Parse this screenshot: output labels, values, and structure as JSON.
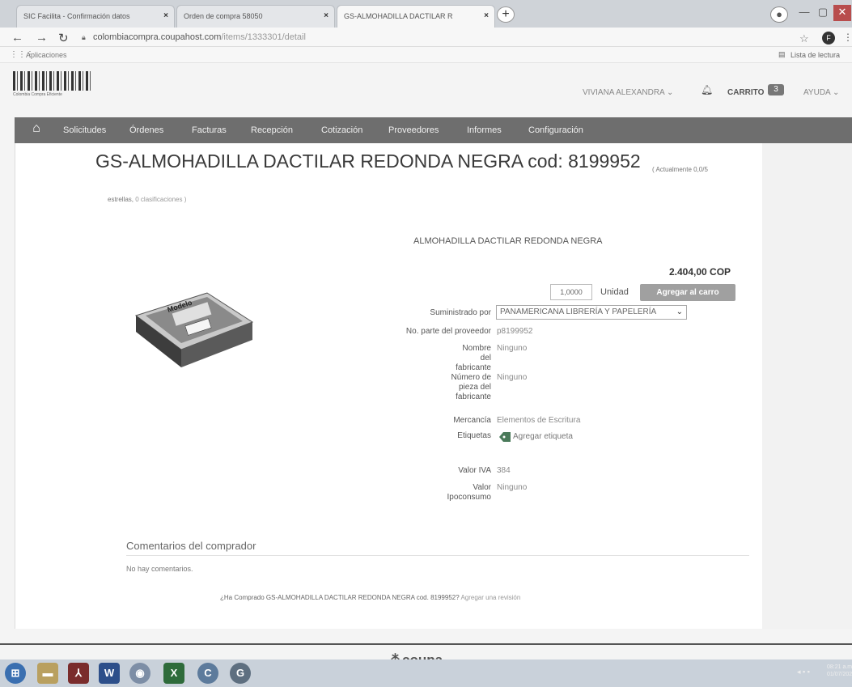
{
  "browser": {
    "tabs": [
      {
        "label": "SIC Facilita - Confirmación datos",
        "close": "×"
      },
      {
        "label": "Orden de compra 58050",
        "close": "×"
      },
      {
        "label": "GS-ALMOHADILLA DACTILAR R",
        "close": "×"
      }
    ],
    "new_tab": "+",
    "url_host": "colombiacompra.coupahost.com",
    "url_path": "/items/1333301/detail",
    "bookmarks_label": "Aplicaciones",
    "reading_list": "Lista de lectura",
    "profile_initial": "F"
  },
  "header": {
    "logo_caption": "Colombia Compra Eficiente",
    "user": "VIVIANA ALEXANDRA",
    "cart_label": "CARRITO",
    "cart_count": "3",
    "help": "AYUDA"
  },
  "nav": {
    "items": [
      "Solicitudes",
      "Órdenes",
      "Facturas",
      "Recepción",
      "Cotización",
      "Proveedores",
      "Informes",
      "Configuración"
    ]
  },
  "item": {
    "title": "GS-ALMOHADILLA DACTILAR REDONDA NEGRA cod: 8199952",
    "rating_part1": "( Actualmente 0,0/5",
    "rating_part2a": "estrellas,",
    "rating_part2b": "0 clasificaciones )",
    "product_name": "ALMOHADILLA DACTILAR REDONDA NEGRA",
    "price": "2.404,00 COP",
    "quantity": "1,0000",
    "unit": "Unidad",
    "add_to_cart": "Agregar al carro",
    "supplier_label": "Suministrado por",
    "supplier_value": "PANAMERICANA LIBRERÍA Y PAPELERÍA",
    "part_label": "No. parte del proveedor",
    "part_value": "p8199952",
    "mfr_name_label": "Nombre del fabricante",
    "mfr_name_value": "Ninguno",
    "mfr_part_label": "Número de pieza del fabricante",
    "mfr_part_value": "Ninguno",
    "commodity_label": "Mercancía",
    "commodity_value": "Elementos de Escritura",
    "tags_label": "Etiquetas",
    "tags_value": "Agregar etiqueta",
    "iva_label": "Valor IVA",
    "iva_value": "384",
    "ipo_label": "Valor Ipoconsumo",
    "ipo_value": "Ninguno"
  },
  "comments": {
    "title": "Comentarios del comprador",
    "empty": "No hay comentarios.",
    "review_question": "¿Ha Comprado GS-ALMOHADILLA DACTILAR REDONDA NEGRA cod. 8199952?",
    "review_link": "Agregar una revisión"
  },
  "footer": {
    "brand": "coupa"
  },
  "taskbar": {
    "clock_time": "08:21 a.m.",
    "clock_date": "01/07/2021"
  }
}
